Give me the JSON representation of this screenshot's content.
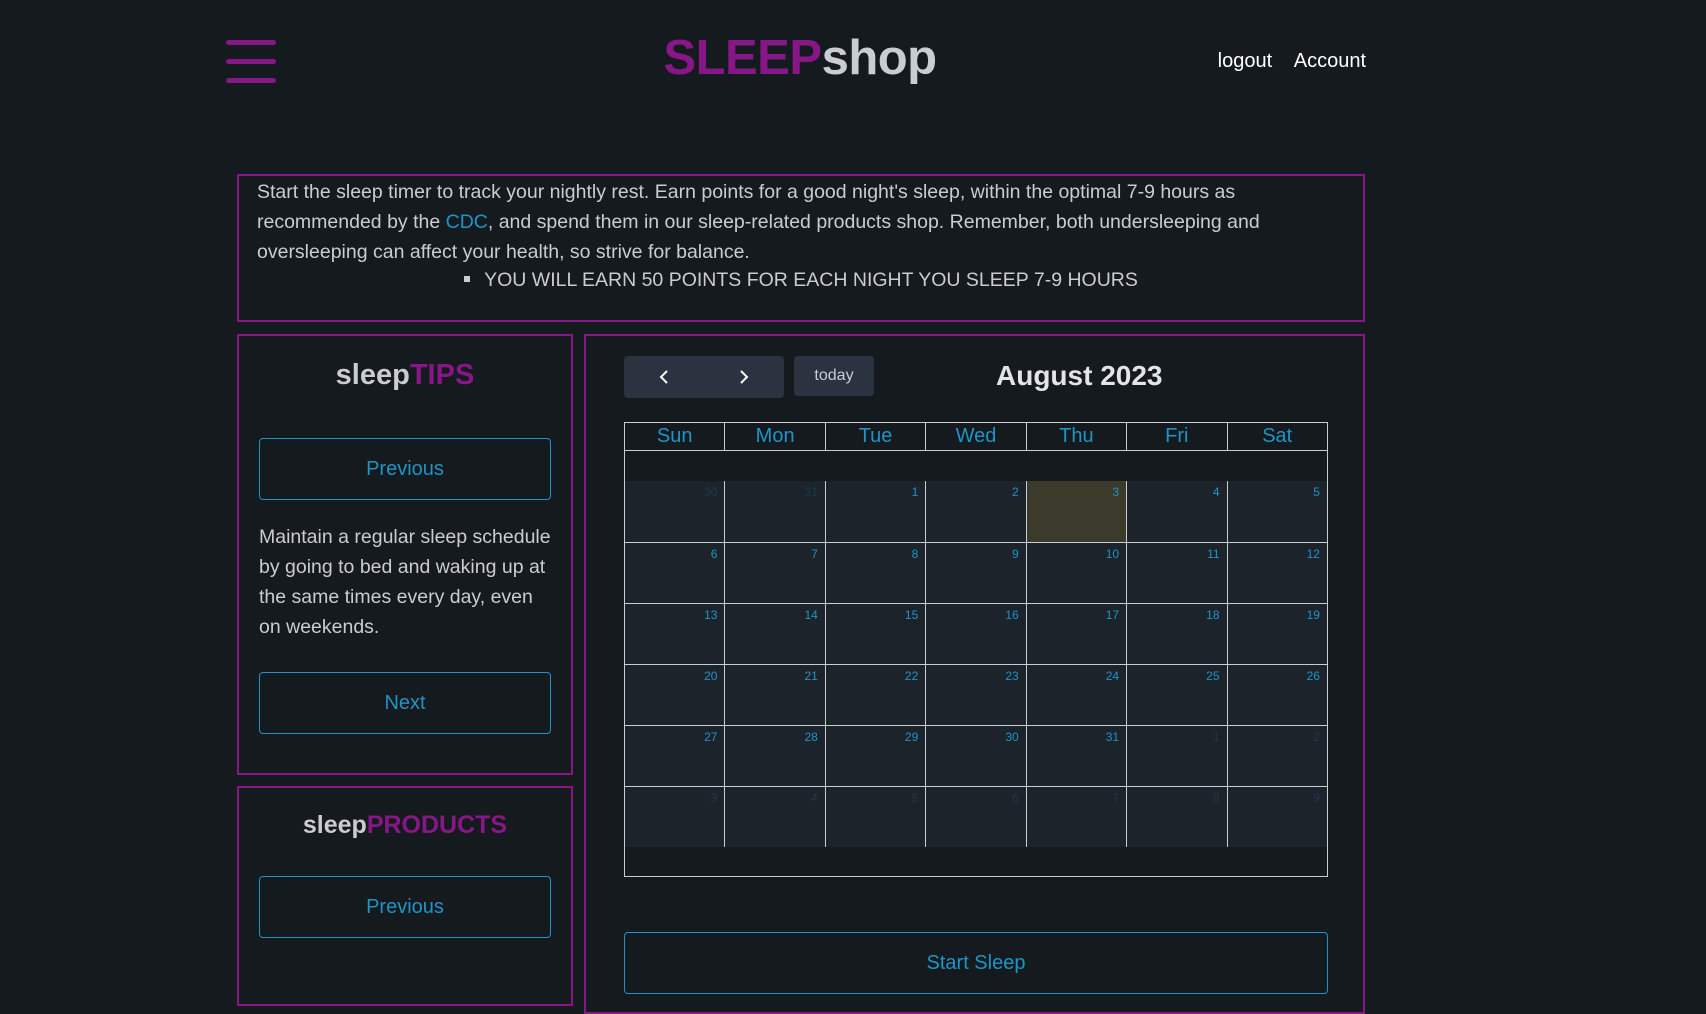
{
  "header": {
    "logo_part1": "SLEEP",
    "logo_part2": "shop",
    "logout_label": "logout",
    "account_label": "Account",
    "menu_icon": "hamburger-menu-icon"
  },
  "intro": {
    "text_before_link": "Start the sleep timer to track your nightly rest. Earn points for a good night's sleep, within the optimal 7-9 hours as recommended by the ",
    "link_text": "CDC",
    "text_after_link": ", and spend them in our sleep-related products shop. Remember, both undersleeping and oversleeping can affect your health, so strive for balance.",
    "bullet": "YOU WILL EARN 50 POINTS FOR EACH NIGHT YOU SLEEP 7-9 HOURS"
  },
  "tips": {
    "title_part1": "sleep",
    "title_part2": "TIPS",
    "previous_label": "Previous",
    "tip_text": "Maintain a regular sleep schedule by going to bed and waking up at the same times every day, even on weekends.",
    "next_label": "Next"
  },
  "products": {
    "title_part1": "sleep",
    "title_part2": "PRODUCTS",
    "previous_label": "Previous"
  },
  "calendar": {
    "prev_icon": "chevron-left-icon",
    "next_icon": "chevron-right-icon",
    "today_label": "today",
    "title": "August 2023",
    "days_of_week": [
      "Sun",
      "Mon",
      "Tue",
      "Wed",
      "Thu",
      "Fri",
      "Sat"
    ],
    "weeks": [
      [
        {
          "d": "30",
          "other": true
        },
        {
          "d": "31",
          "other": true
        },
        {
          "d": "1"
        },
        {
          "d": "2"
        },
        {
          "d": "3",
          "today": true
        },
        {
          "d": "4"
        },
        {
          "d": "5"
        }
      ],
      [
        {
          "d": "6"
        },
        {
          "d": "7"
        },
        {
          "d": "8"
        },
        {
          "d": "9"
        },
        {
          "d": "10"
        },
        {
          "d": "11"
        },
        {
          "d": "12"
        }
      ],
      [
        {
          "d": "13"
        },
        {
          "d": "14"
        },
        {
          "d": "15"
        },
        {
          "d": "16"
        },
        {
          "d": "17"
        },
        {
          "d": "18"
        },
        {
          "d": "19"
        }
      ],
      [
        {
          "d": "20"
        },
        {
          "d": "21"
        },
        {
          "d": "22"
        },
        {
          "d": "23"
        },
        {
          "d": "24"
        },
        {
          "d": "25"
        },
        {
          "d": "26"
        }
      ],
      [
        {
          "d": "27"
        },
        {
          "d": "28"
        },
        {
          "d": "29"
        },
        {
          "d": "30"
        },
        {
          "d": "31"
        },
        {
          "d": "1",
          "other": true
        },
        {
          "d": "2",
          "other": true
        }
      ],
      [
        {
          "d": "3",
          "other": true
        },
        {
          "d": "4",
          "other": true
        },
        {
          "d": "5",
          "other": true
        },
        {
          "d": "6",
          "other": true
        },
        {
          "d": "7",
          "other": true
        },
        {
          "d": "8",
          "other": true
        },
        {
          "d": "9",
          "other": true
        }
      ]
    ],
    "start_sleep_label": "Start Sleep"
  },
  "colors": {
    "background": "#151a1f",
    "brand_purple": "#871687",
    "accent_blue": "#1e94c7",
    "today_highlight": "#3b3a2b"
  }
}
